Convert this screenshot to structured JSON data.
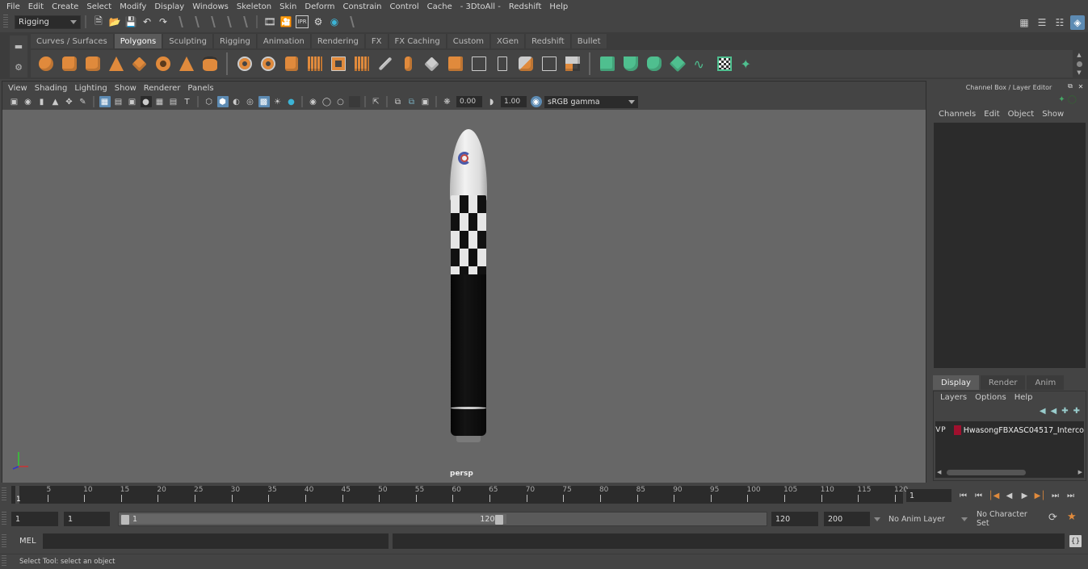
{
  "menubar": {
    "items": [
      "File",
      "Edit",
      "Create",
      "Select",
      "Modify",
      "Display",
      "Windows",
      "Skeleton",
      "Skin",
      "Deform",
      "Constrain",
      "Control",
      "Cache",
      "- 3DtoAll -",
      "Redshift",
      "Help"
    ]
  },
  "statusline": {
    "mode": "Rigging",
    "icons": [
      "new-scene-icon",
      "open-scene-icon",
      "save-scene-icon",
      "undo-icon",
      "redo-icon"
    ],
    "render_icons": [
      "render-view-icon",
      "render-frame-icon",
      "ipr-render-icon",
      "render-settings-icon",
      "hypershade-icon"
    ]
  },
  "right_icons": [
    "modeling-toolkit-icon",
    "attribute-editor-icon",
    "tool-settings-icon",
    "channel-box-icon"
  ],
  "shelf": {
    "tabs": [
      "Curves / Surfaces",
      "Polygons",
      "Sculpting",
      "Rigging",
      "Animation",
      "Rendering",
      "FX",
      "FX Caching",
      "Custom",
      "XGen",
      "Redshift",
      "Bullet"
    ],
    "active_tab": "Polygons"
  },
  "viewport": {
    "menu": [
      "View",
      "Shading",
      "Lighting",
      "Show",
      "Renderer",
      "Panels"
    ],
    "exposure": "0.00",
    "gamma": "1.00",
    "colorspace": "sRGB gamma",
    "camera_label": "persp"
  },
  "channel_box": {
    "title": "Channel Box / Layer Editor",
    "menu": [
      "Channels",
      "Edit",
      "Object",
      "Show"
    ]
  },
  "layer_editor": {
    "tabs": [
      "Display",
      "Render",
      "Anim"
    ],
    "active_tab": "Display",
    "menu": [
      "Layers",
      "Options",
      "Help"
    ],
    "layers": [
      {
        "visible": "V",
        "playback": "P",
        "color": "#a0102e",
        "name": "HwasongFBXASC04517_Interco"
      }
    ]
  },
  "timeline": {
    "ticks": [
      1,
      5,
      10,
      15,
      20,
      25,
      30,
      35,
      40,
      45,
      50,
      55,
      60,
      65,
      70,
      75,
      80,
      85,
      90,
      95,
      100,
      105,
      110,
      115,
      120
    ],
    "current_frame": "1",
    "playback_buttons": [
      "go-to-start-icon",
      "step-back-key-icon",
      "step-back-frame-icon",
      "play-backward-icon",
      "play-forward-icon",
      "step-forward-key-icon",
      "step-forward-frame-icon",
      "go-to-end-icon"
    ]
  },
  "range": {
    "start": "1",
    "anim_start": "1",
    "slider_start": "1",
    "slider_end": "120",
    "anim_end": "120",
    "end": "200",
    "anim_layer": "No Anim Layer",
    "character_set": "No Character Set"
  },
  "command_line": {
    "label": "MEL"
  },
  "help_line": {
    "text": "Select Tool: select an object"
  }
}
